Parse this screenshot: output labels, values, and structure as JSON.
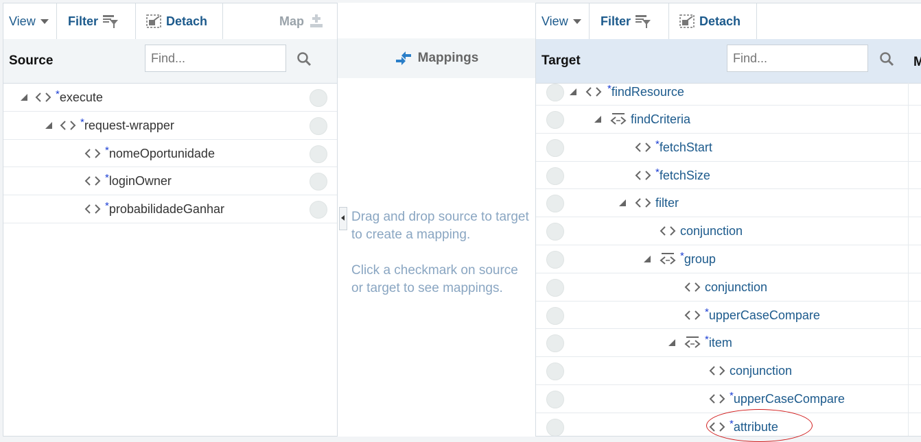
{
  "source": {
    "toolbar": {
      "view": "View",
      "filter": "Filter",
      "detach": "Detach",
      "map": "Map"
    },
    "title": "Source",
    "find_placeholder": "Find...",
    "rows": [
      {
        "label": "execute",
        "required": "*"
      },
      {
        "label": "request-wrapper",
        "required": "*"
      },
      {
        "label": "nomeOportunidade",
        "required": "*"
      },
      {
        "label": "loginOwner",
        "required": "*"
      },
      {
        "label": "probabilidadeGanhar",
        "required": "*"
      }
    ]
  },
  "middle": {
    "title": "Mappings",
    "hint1": "Drag and drop source to target to create a mapping.",
    "hint2": "Click a checkmark on source or target to see mappings."
  },
  "target": {
    "toolbar": {
      "view": "View",
      "filter": "Filter",
      "detach": "Detach"
    },
    "title": "Target",
    "find_placeholder": "Find...",
    "col_m": "M",
    "rows": [
      {
        "label": "findResource",
        "required": "*"
      },
      {
        "label": "findCriteria",
        "required": ""
      },
      {
        "label": "fetchStart",
        "required": "*"
      },
      {
        "label": "fetchSize",
        "required": "*"
      },
      {
        "label": "filter",
        "required": ""
      },
      {
        "label": "conjunction",
        "required": ""
      },
      {
        "label": "group",
        "required": "*"
      },
      {
        "label": "conjunction",
        "required": ""
      },
      {
        "label": "upperCaseCompare",
        "required": "*"
      },
      {
        "label": "item",
        "required": "*"
      },
      {
        "label": "conjunction",
        "required": ""
      },
      {
        "label": "upperCaseCompare",
        "required": "*"
      },
      {
        "label": "attribute",
        "required": "*"
      }
    ]
  },
  "colors": {
    "link": "#1c5a8c",
    "required": "#1c3fd4",
    "annotation": "#d11a1a"
  }
}
